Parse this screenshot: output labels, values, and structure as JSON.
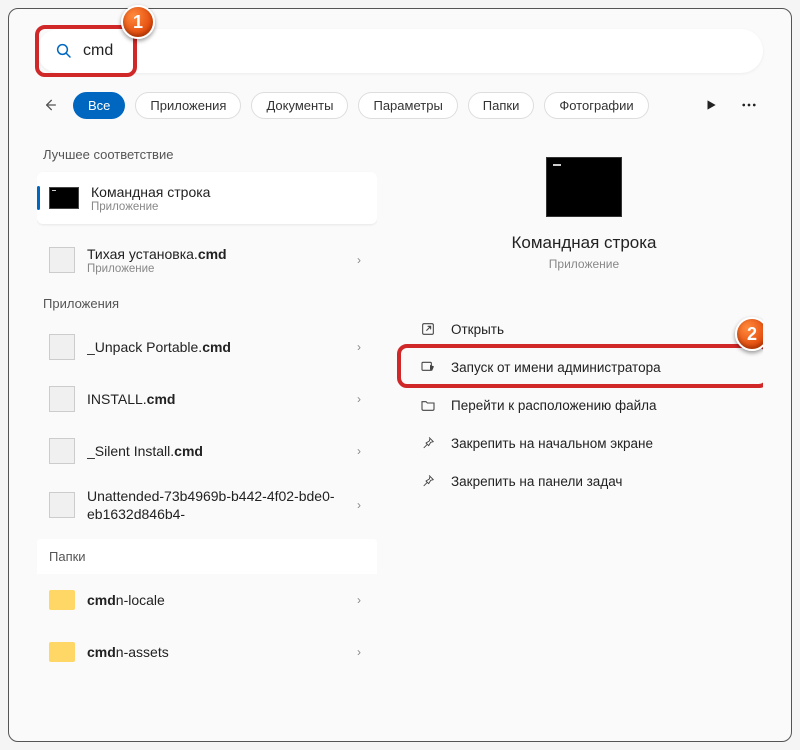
{
  "search": {
    "value": "cmd"
  },
  "filters": {
    "all": "Все",
    "apps": "Приложения",
    "docs": "Документы",
    "params": "Параметры",
    "folders": "Папки",
    "photos": "Фотографии"
  },
  "sections": {
    "best": "Лучшее соответствие",
    "apps": "Приложения",
    "folders": "Папки"
  },
  "best": [
    {
      "title": "Командная строка",
      "sub": "Приложение"
    },
    {
      "pre": "Тихая установка.",
      "bold": "cmd",
      "sub": "Приложение"
    }
  ],
  "app_results": [
    {
      "pre": "_Unpack Portable.",
      "bold": "cmd"
    },
    {
      "pre": "INSTALL.",
      "bold": "cmd"
    },
    {
      "pre": "_Silent Install.",
      "bold": "cmd"
    },
    {
      "pre": "Unattended-73b4969b-b442-4f02-bde0-eb1632d846b4-",
      "bold": ""
    }
  ],
  "folder_results": [
    {
      "bold": "cmd",
      "post": "n-locale"
    },
    {
      "bold": "cmd",
      "post": "n-assets"
    }
  ],
  "preview": {
    "title": "Командная строка",
    "sub": "Приложение"
  },
  "actions": {
    "open": "Открыть",
    "admin": "Запуск от имени администратора",
    "location": "Перейти к расположению файла",
    "pin_start": "Закрепить на начальном экране",
    "pin_taskbar": "Закрепить на панели задач"
  },
  "badges": {
    "b1": "1",
    "b2": "2"
  }
}
